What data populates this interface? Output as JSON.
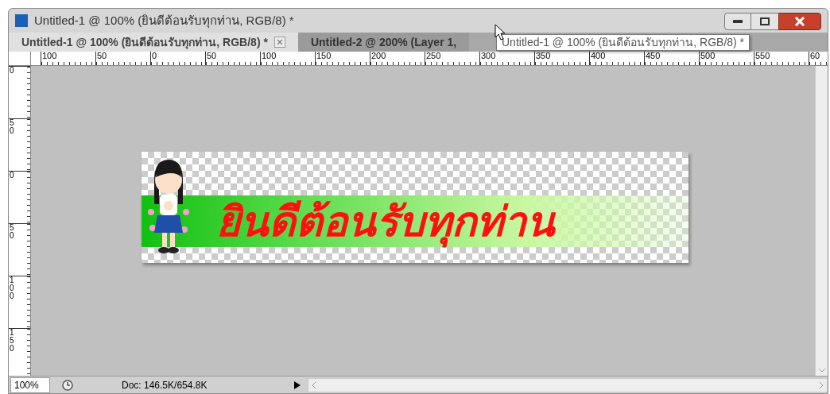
{
  "window": {
    "title": "Untitled-1 @ 100% (ยินดีต้อนรับทุกท่าน, RGB/8) *"
  },
  "tabs": [
    {
      "label": "Untitled-1 @ 100% (ยินดีต้อนรับทุกท่าน, RGB/8) *",
      "selected": true,
      "closable": true
    },
    {
      "label": "Untitled-2 @ 200% (Layer 1,",
      "selected": false,
      "closable": false
    }
  ],
  "tooltip": "Untitled-1 @ 100% (ยินดีต้อนรับทุกท่าน, RGB/8) *",
  "ruler_horizontal": [
    "100",
    "50",
    "0",
    "50",
    "100",
    "150",
    "200",
    "250",
    "300",
    "350",
    "400",
    "450",
    "500",
    "550",
    "60"
  ],
  "ruler_vertical": [
    "0",
    "50",
    "0",
    "50",
    "100",
    "150"
  ],
  "canvas": {
    "banner_text": "ยินดีต้อนรับทุกท่าน"
  },
  "status_bar": {
    "zoom": "100%",
    "doc_info": "Doc: 146.5K/654.8K"
  }
}
